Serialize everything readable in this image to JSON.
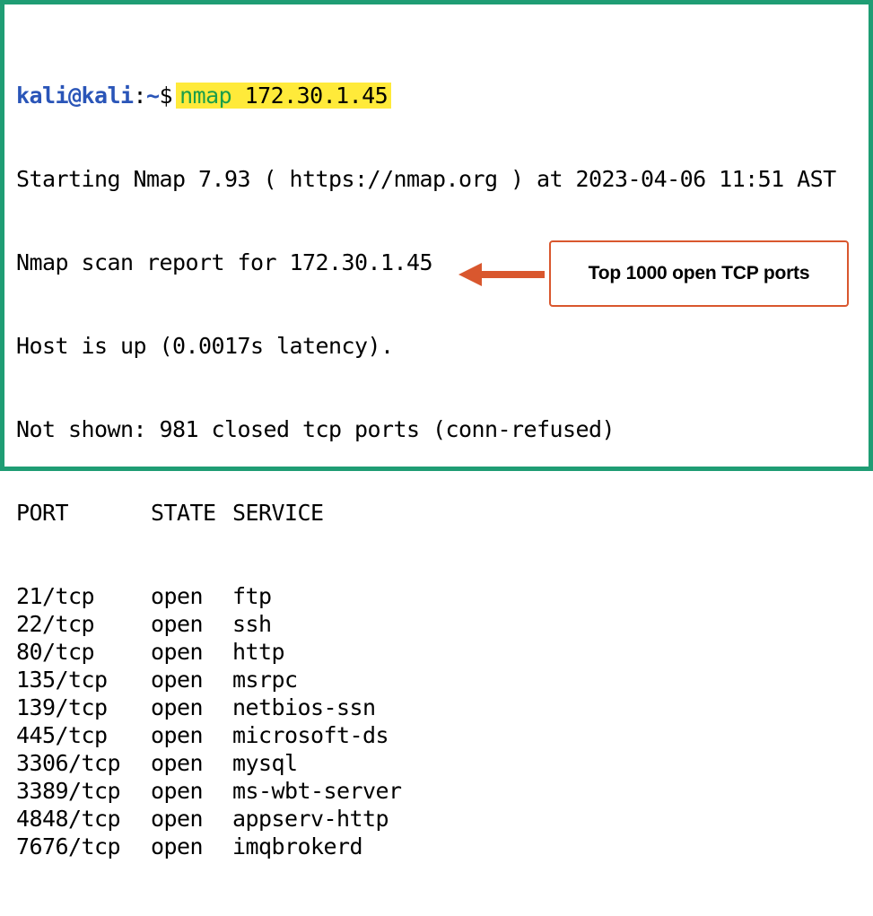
{
  "terminal": {
    "prompt": {
      "user_host": "kali@kali",
      "colon": ":",
      "path": "~",
      "dollar": "$"
    },
    "command": {
      "name": "nmap",
      "argument": "172.30.1.45"
    },
    "output_lines": [
      "Starting Nmap 7.93 ( https://nmap.org ) at 2023-04-06 11:51 AST",
      "Nmap scan report for 172.30.1.45",
      "Host is up (0.0017s latency).",
      "Not shown: 981 closed tcp ports (conn-refused)"
    ],
    "table_headers": {
      "port": "PORT",
      "state": "STATE",
      "service": "SERVICE"
    },
    "ports": [
      {
        "port": "21/tcp",
        "state": "open",
        "service": "ftp"
      },
      {
        "port": "22/tcp",
        "state": "open",
        "service": "ssh"
      },
      {
        "port": "80/tcp",
        "state": "open",
        "service": "http"
      },
      {
        "port": "135/tcp",
        "state": "open",
        "service": "msrpc"
      },
      {
        "port": "139/tcp",
        "state": "open",
        "service": "netbios-ssn"
      },
      {
        "port": "445/tcp",
        "state": "open",
        "service": "microsoft-ds"
      },
      {
        "port": "3306/tcp",
        "state": "open",
        "service": "mysql"
      },
      {
        "port": "3389/tcp",
        "state": "open",
        "service": "ms-wbt-server"
      },
      {
        "port": "4848/tcp",
        "state": "open",
        "service": "appserv-http"
      },
      {
        "port": "7676/tcp",
        "state": "open",
        "service": "imqbrokerd"
      }
    ]
  },
  "annotation": {
    "label": "Top 1000 open TCP ports",
    "arrow_icon": "left-arrow-icon"
  },
  "colors": {
    "border": "#1f9d74",
    "prompt": "#2a55b8",
    "command_name": "#1b9e4a",
    "command_highlight": "#ffea3a",
    "annotation_accent": "#d9572e"
  }
}
